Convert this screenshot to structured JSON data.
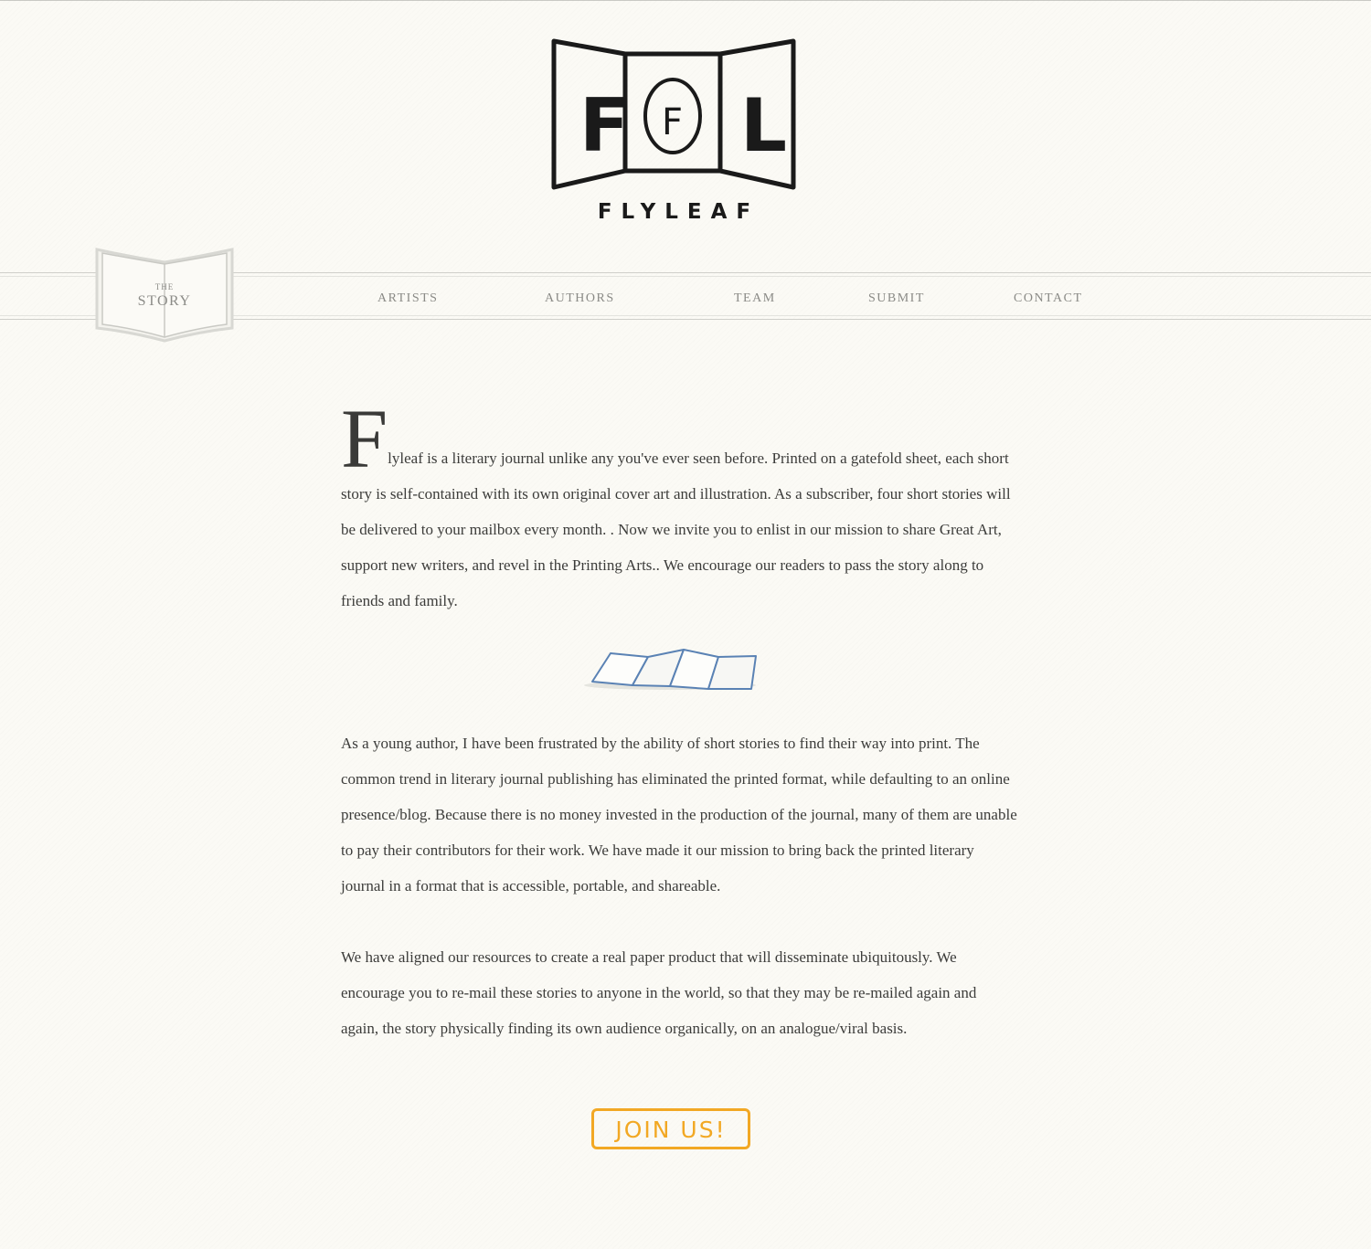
{
  "header": {
    "logo_letters": [
      "F",
      "F",
      "L"
    ],
    "brand_name": "FLYLEAF"
  },
  "nav": {
    "badge_small": "THE",
    "badge_label": "STORY",
    "items": [
      {
        "label": "ARTISTS"
      },
      {
        "label": "AUTHORS"
      },
      {
        "label": "TEAM"
      },
      {
        "label": "SUBMIT"
      },
      {
        "label": "CONTACT"
      }
    ]
  },
  "content": {
    "drop_cap": "F",
    "paragraph1_rest": "lyleaf is a literary journal unlike any you've ever seen before. Printed on a gatefold sheet, each short story is self-contained with its own original cover art and illustration. As a subscriber, four short stories will be delivered to your mailbox every month. . Now we invite you to enlist in our mission to share Great Art, support new writers, and revel in the Printing Arts.. We encourage our readers to pass the story along to friends and family.",
    "paragraph2": "As a young author, I have been frustrated by the ability of short stories to find their way into print. The common trend in literary journal publishing has eliminated the printed format, while defaulting to an online presence/blog. Because there is no money invested in the production of the journal, many of them are unable to pay their contributors for their work. We have made it our mission to bring back the printed literary journal in a format that is accessible, portable, and shareable.",
    "paragraph3": "We have aligned our resources to create a real paper product that will disseminate ubiquitously. We encourage you to re-mail these stories to anyone in the world, so that they may be re-mailed again and again, the story physically finding its own audience organically, on an analogue/viral basis."
  },
  "cta": {
    "label": "JOIN US!"
  },
  "colors": {
    "background": "#fbfaf5",
    "text": "#3c3c3a",
    "nav_text": "#8a8a86",
    "accent": "#f2a824",
    "gatefold_stroke": "#5a82b4"
  }
}
